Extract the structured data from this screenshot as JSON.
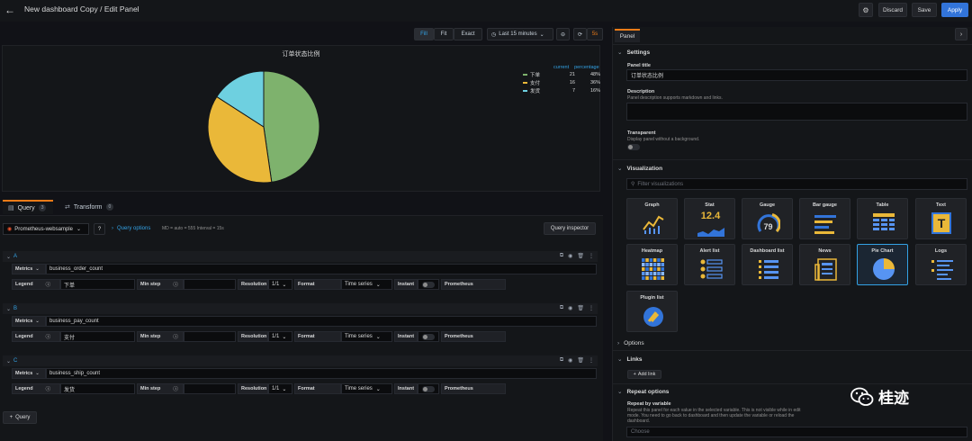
{
  "header": {
    "title": "New dashboard Copy / Edit Panel",
    "discard": "Discard",
    "save": "Save",
    "apply": "Apply"
  },
  "toolbar": {
    "fill": "Fill",
    "fit": "Fit",
    "exact": "Exact",
    "time_range": "Last 15 minutes",
    "refresh": "5s"
  },
  "panel": {
    "title": "订单状态比例",
    "legend_headers": [
      "current",
      "percentage"
    ]
  },
  "chart_data": {
    "type": "pie",
    "title": "订单状态比例",
    "categories": [
      "下单",
      "支付",
      "发货"
    ],
    "values": [
      21,
      16,
      7
    ],
    "percentages": [
      "48%",
      "36%",
      "16%"
    ],
    "colors": [
      "#7eb26d",
      "#eab839",
      "#6ed0e0"
    ],
    "legend_placement": "right"
  },
  "tabs": {
    "query": "Query",
    "query_count": "3",
    "transform": "Transform",
    "transform_count": "0"
  },
  "query_bar": {
    "datasource": "Prometheus-websample",
    "options": "Query options",
    "meta": "MD = auto = 555     Interval = 15s",
    "inspector": "Query inspector"
  },
  "labels": {
    "metrics": "Metrics",
    "legend": "Legend",
    "min_step": "Min step",
    "resolution": "Resolution",
    "resolution_value": "1/1",
    "format": "Format",
    "format_value": "Time series",
    "instant": "Instant",
    "prometheus": "Prometheus"
  },
  "queries": [
    {
      "letter": "A",
      "metric": "business_order_count",
      "legend": "下单"
    },
    {
      "letter": "B",
      "metric": "business_pay_count",
      "legend": "支付"
    },
    {
      "letter": "C",
      "metric": "business_ship_count",
      "legend": "发货"
    }
  ],
  "add_query": "Query",
  "right": {
    "tab": "Panel",
    "settings": "Settings",
    "panel_title_label": "Panel title",
    "panel_title_value": "订单状态比例",
    "description_label": "Description",
    "description_help": "Panel description supports markdown and links.",
    "transparent_label": "Transparent",
    "transparent_help": "Display panel without a background.",
    "visualization": "Visualization",
    "filter_placeholder": "Filter visualizations",
    "viz": [
      "Graph",
      "Stat",
      "Gauge",
      "Bar gauge",
      "Table",
      "Text",
      "Heatmap",
      "Alert list",
      "Dashboard list",
      "News",
      "Pie Chart",
      "Logs",
      "Plugin list"
    ],
    "stat_value": "12.4",
    "gauge_value": "79",
    "options": "Options",
    "links": "Links",
    "add_link": "Add link",
    "repeat": "Repeat options",
    "repeat_label": "Repeat by variable",
    "repeat_help_1": "Repeat this panel for each value in the selected variable. This is not visible while in edit",
    "repeat_help_2": "mode. You need to go back to dashboard and then update the variable or reload the",
    "repeat_help_3": "dashboard.",
    "choose": "Choose"
  },
  "watermark": "桂迹"
}
